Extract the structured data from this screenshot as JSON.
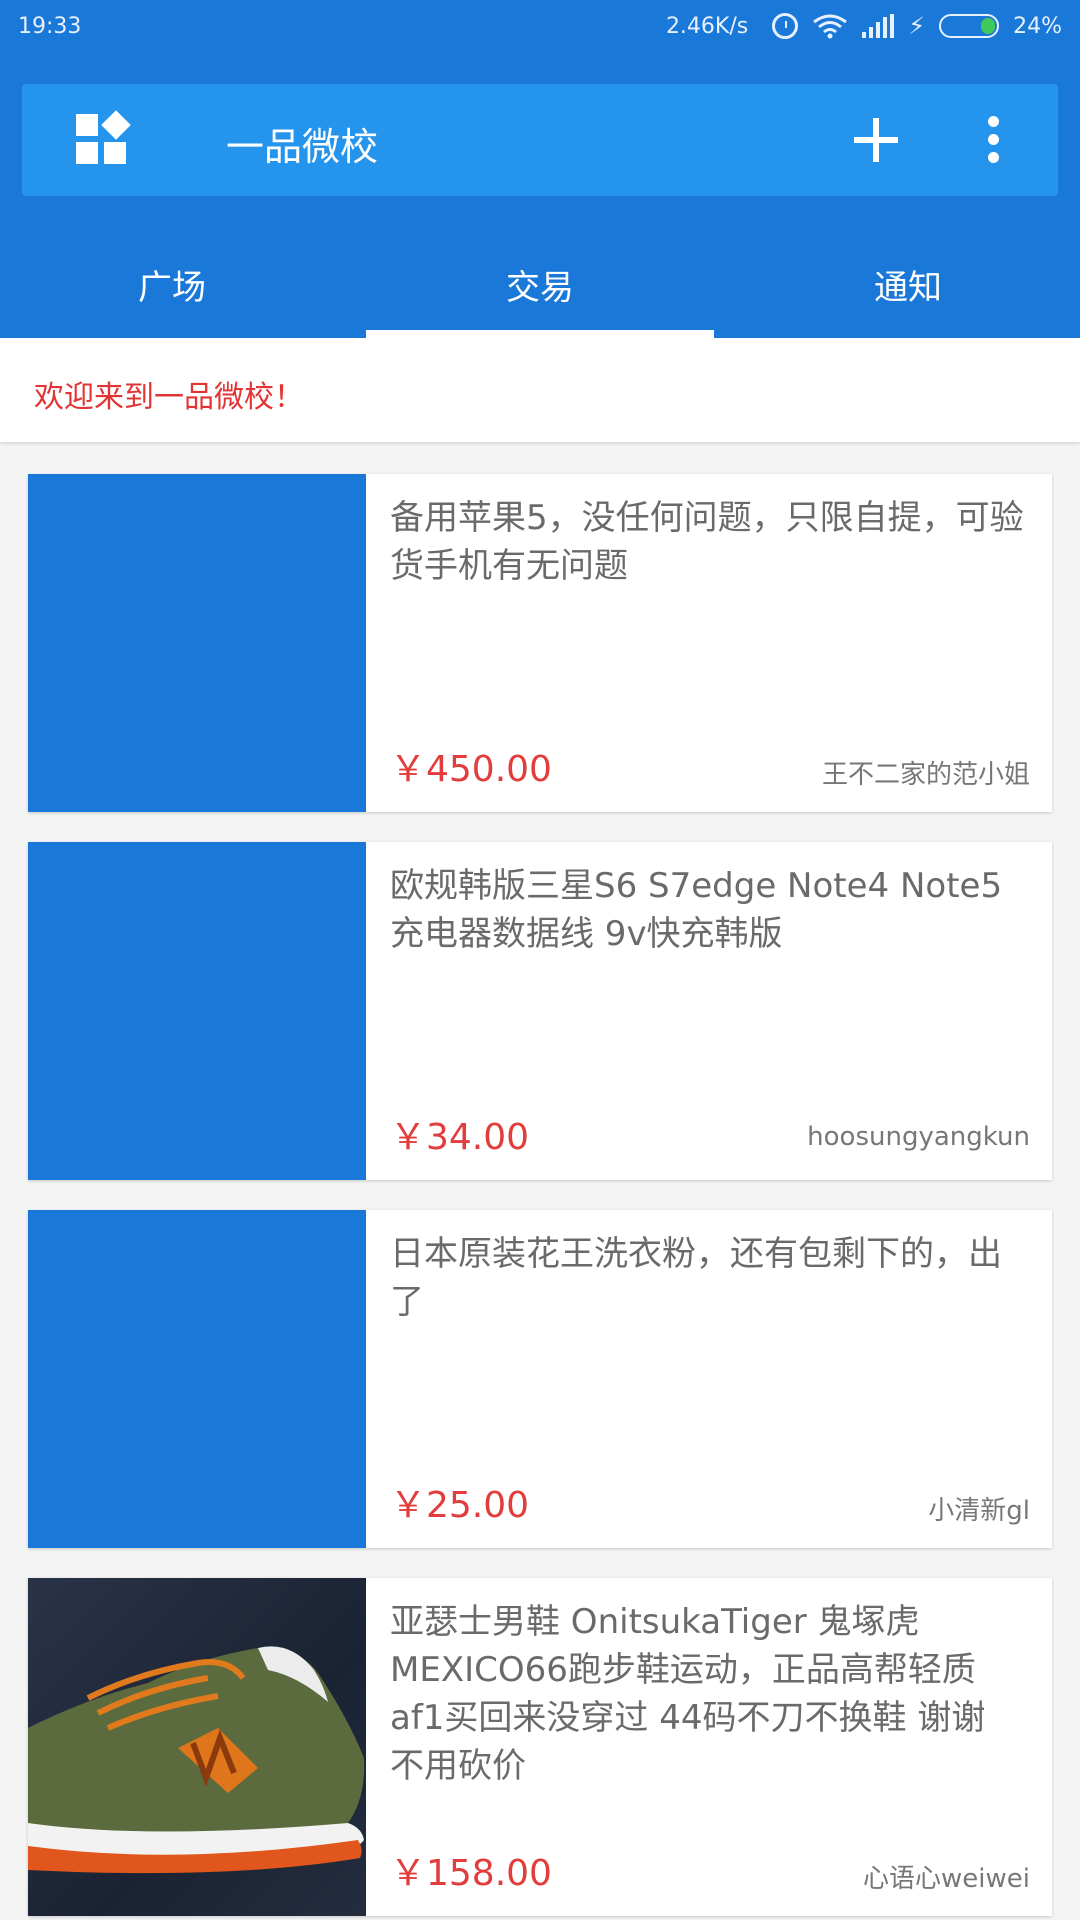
{
  "status_bar": {
    "time": "19:33",
    "net_speed": "2.46K/s",
    "battery": "24%",
    "icons": [
      "alarm-icon",
      "wifi-icon",
      "signal-icon",
      "charging-icon",
      "battery-icon"
    ]
  },
  "toolbar": {
    "title": "一品微校",
    "icons": [
      "grid-icon",
      "plus-icon",
      "more-icon"
    ]
  },
  "tabs": [
    {
      "label": "广场"
    },
    {
      "label": "交易"
    },
    {
      "label": "通知"
    }
  ],
  "welcome_text": "欢迎来到一品微校！",
  "listings": [
    {
      "title": "备用苹果5，没任何问题，只限自提，可验货手机有无问题",
      "price": "￥450.00",
      "seller": "王不二家的范小姐"
    },
    {
      "title": "欧规韩版三星S6 S7edge Note4 Note5充电器数据线 9v快充韩版",
      "price": "￥34.00",
      "seller": "hoosungyangkun"
    },
    {
      "title": "日本原装花王洗衣粉，还有包剩下的，出了",
      "price": "￥25.00",
      "seller": "小清新gl"
    },
    {
      "title": "亚瑟士男鞋 OnitsukaTiger 鬼塚虎 MEXICO66跑步鞋运动，正品高帮轻质af1买回来没穿过 44码不刀不换鞋 谢谢 不用砍价",
      "price": "￥158.00",
      "seller": "心语心weiwei"
    }
  ],
  "colors": {
    "primary": "#1a78d8",
    "toolbar": "#2594ec",
    "price": "#e23c3c",
    "welcome": "#e23434"
  }
}
